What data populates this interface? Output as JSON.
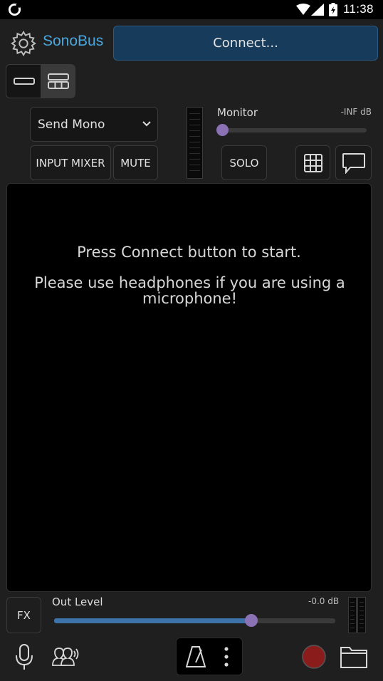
{
  "status_bar": {
    "time": "11:38"
  },
  "header": {
    "app_name": "SonoBus",
    "connect_label": "Connect...",
    "settings_icon": "gear-icon"
  },
  "view_toggle": {
    "options": [
      "single-row-icon",
      "grid-rows-icon"
    ],
    "selected": 1
  },
  "controls": {
    "send_mode": "Send Mono",
    "input_mixer_label": "INPUT MIXER",
    "mute_label": "MUTE",
    "solo_label": "SOLO",
    "grid_icon": "grid-icon",
    "chat_icon": "chat-icon"
  },
  "monitor": {
    "label": "Monitor",
    "level_text": "-INF dB",
    "value_fraction": 0
  },
  "main": {
    "message_line1": "Press Connect button to start.",
    "message_line2": "Please use headphones if you are using a microphone!"
  },
  "output": {
    "fx_label": "FX",
    "label": "Out Level",
    "level_text": "-0.0 dB",
    "value_fraction": 0.7
  },
  "bottom_bar": {
    "icons": [
      "microphone-icon",
      "peers-icon",
      "metronome-icon",
      "more-vertical-icon",
      "record-icon",
      "folder-icon"
    ]
  },
  "colors": {
    "accent": "#4aa8e0",
    "connect_bg": "#173b5a",
    "slider_thumb": "#8a72b5",
    "slider_fill": "#3d73a8",
    "record": "#8b1c1c"
  }
}
